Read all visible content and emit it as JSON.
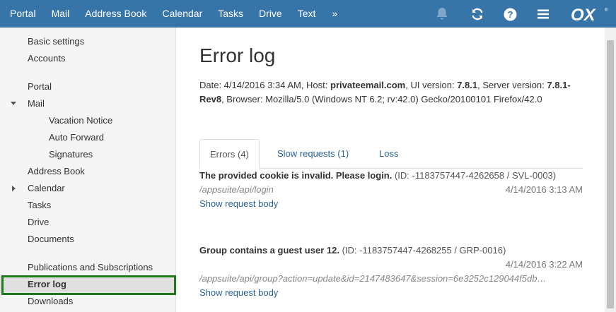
{
  "topbar": {
    "nav": [
      "Portal",
      "Mail",
      "Address Book",
      "Calendar",
      "Tasks",
      "Drive",
      "Text"
    ],
    "more_label": "»",
    "icons": [
      "bell-icon",
      "refresh-icon",
      "help-icon",
      "menu-icon"
    ],
    "logo_text": "OX",
    "bar_color": "#3774a8"
  },
  "sidebar": {
    "items": [
      {
        "label": "Basic settings"
      },
      {
        "label": "Accounts"
      },
      {
        "label": "Portal"
      },
      {
        "label": "Mail"
      },
      {
        "label": "Vacation Notice"
      },
      {
        "label": "Auto Forward"
      },
      {
        "label": "Signatures"
      },
      {
        "label": "Address Book"
      },
      {
        "label": "Calendar"
      },
      {
        "label": "Tasks"
      },
      {
        "label": "Drive"
      },
      {
        "label": "Documents"
      },
      {
        "label": "Publications and Subscriptions"
      },
      {
        "label": "Error log"
      },
      {
        "label": "Downloads"
      }
    ],
    "highlight_color": "#1f7a1f"
  },
  "main": {
    "title": "Error log",
    "meta": {
      "date_label": "Date: 4/14/2016 3:34 AM, Host: ",
      "host": "privateemail.com",
      "ui_label": ", UI version: ",
      "ui_version": "7.8.1",
      "server_label": ", Server version: ",
      "server_version": "7.8.1-Rev8",
      "browser_text": ", Browser: Mozilla/5.0 (Windows NT 6.2; rv:42.0) Gecko/20100101 Firefox/42.0"
    },
    "tabs": [
      {
        "label": "Errors (4)"
      },
      {
        "label": "Slow requests (1)"
      },
      {
        "label": "Loss"
      }
    ],
    "errors": [
      {
        "message": "The provided cookie is invalid. Please login.",
        "ident": " (ID: -1183757447-4262658 / SVL-0003)",
        "time": "4/14/2016 3:13 AM",
        "path": "/appsuite/api/login",
        "link": "Show request body"
      },
      {
        "message": "Group contains a guest user 12.",
        "ident": " (ID: -1183757447-4268255 / GRP-0016)",
        "time": "4/14/2016 3:22 AM",
        "path": "/appsuite/api/group?action=update&id=2147483647&session=6e3252c129044f5db…",
        "link": "Show request body"
      }
    ]
  }
}
